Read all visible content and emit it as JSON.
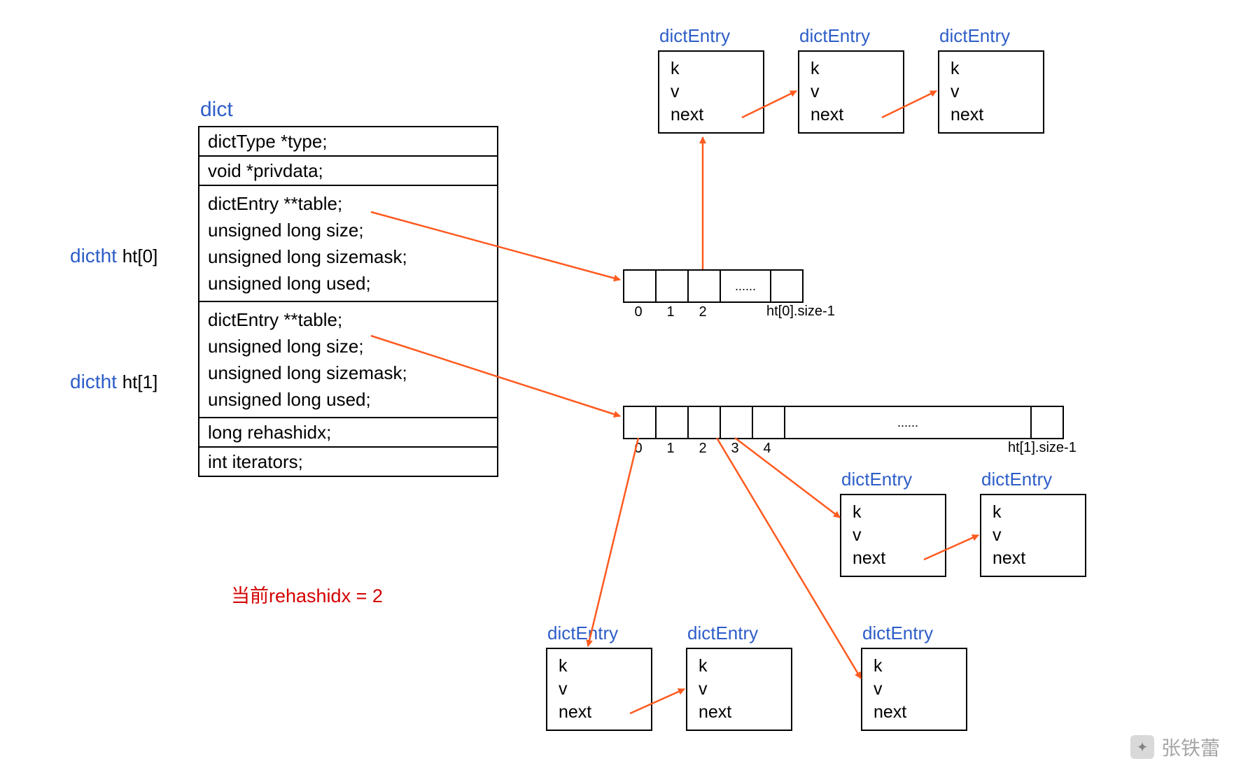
{
  "labels": {
    "dict": "dict",
    "dictht0": "dictht",
    "ht0_suffix": "ht[0]",
    "dictht1": "dictht",
    "ht1_suffix": "ht[1]",
    "dictEntry": "dictEntry",
    "note": "当前rehashidx = 2",
    "watermark": "张铁蕾",
    "ht0_size": "ht[0].size-1",
    "ht1_size": "ht[1].size-1",
    "ellipsis": "......"
  },
  "dict_rows": {
    "type": "dictType *type;",
    "privdata": "void *privdata;",
    "ht_block_lines": [
      "dictEntry **table;",
      "unsigned long size;",
      "unsigned long sizemask;",
      "unsigned long used;"
    ],
    "rehashidx": "long rehashidx;",
    "iterators": "int iterators;"
  },
  "entry_fields": {
    "k": "k",
    "v": "v",
    "next": "next"
  },
  "array0_indices": [
    "0",
    "1",
    "2"
  ],
  "array1_indices": [
    "0",
    "1",
    "2",
    "3",
    "4"
  ]
}
